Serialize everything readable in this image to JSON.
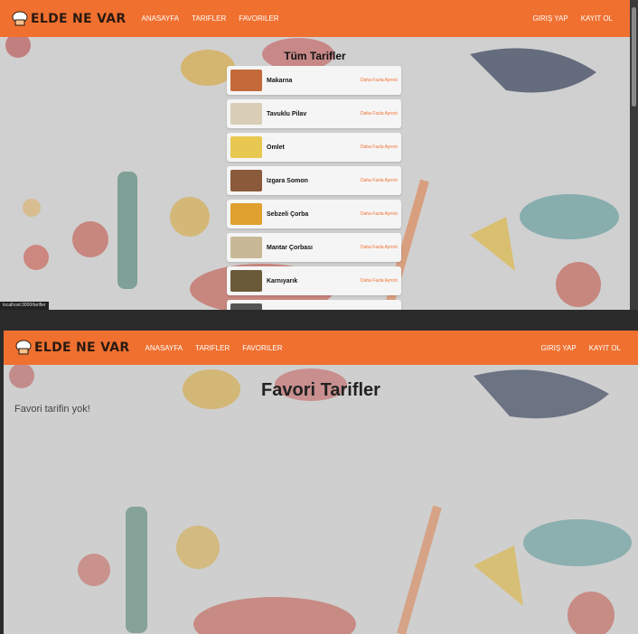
{
  "brand": {
    "name": "ELDE NE VAR"
  },
  "nav": {
    "home": "ANASAYFA",
    "recipes": "TARIFLER",
    "favorites": "FAVORILER",
    "login": "GIRIŞ YAP",
    "register": "KAYIT OL"
  },
  "recipes_page": {
    "title": "Tüm Tarifler",
    "items": [
      {
        "name": "Makarna",
        "link": "Daha Fazla Ayrıntı",
        "thumb_color": "#c46a3a"
      },
      {
        "name": "Tavuklu Pilav",
        "link": "Daha Fazla Ayrıntı",
        "thumb_color": "#d8cdb6"
      },
      {
        "name": "Omlet",
        "link": "Daha Fazla Ayrıntı",
        "thumb_color": "#e8c850"
      },
      {
        "name": "Izgara Somon",
        "link": "Daha Fazla Ayrıntı",
        "thumb_color": "#8a5a3a"
      },
      {
        "name": "Sebzeli Çorba",
        "link": "Daha Fazla Ayrıntı",
        "thumb_color": "#e0a030"
      },
      {
        "name": "Mantar Çorbası",
        "link": "Daha Fazla Ayrıntı",
        "thumb_color": "#c9b898"
      },
      {
        "name": "Karnıyarık",
        "link": "Daha Fazla Ayrıntı",
        "thumb_color": "#6a5a3a"
      },
      {
        "name": "",
        "link": "",
        "thumb_color": "#555555"
      }
    ]
  },
  "status_bar": {
    "url": "localhost:3000/tarifler"
  },
  "favorites_page": {
    "title": "Favori Tarifler",
    "empty_message": "Favori tarifin yok!"
  },
  "colors": {
    "accent": "#f07030",
    "card_bg": "#f5f5f5",
    "page_bg": "#cfcfcf"
  }
}
